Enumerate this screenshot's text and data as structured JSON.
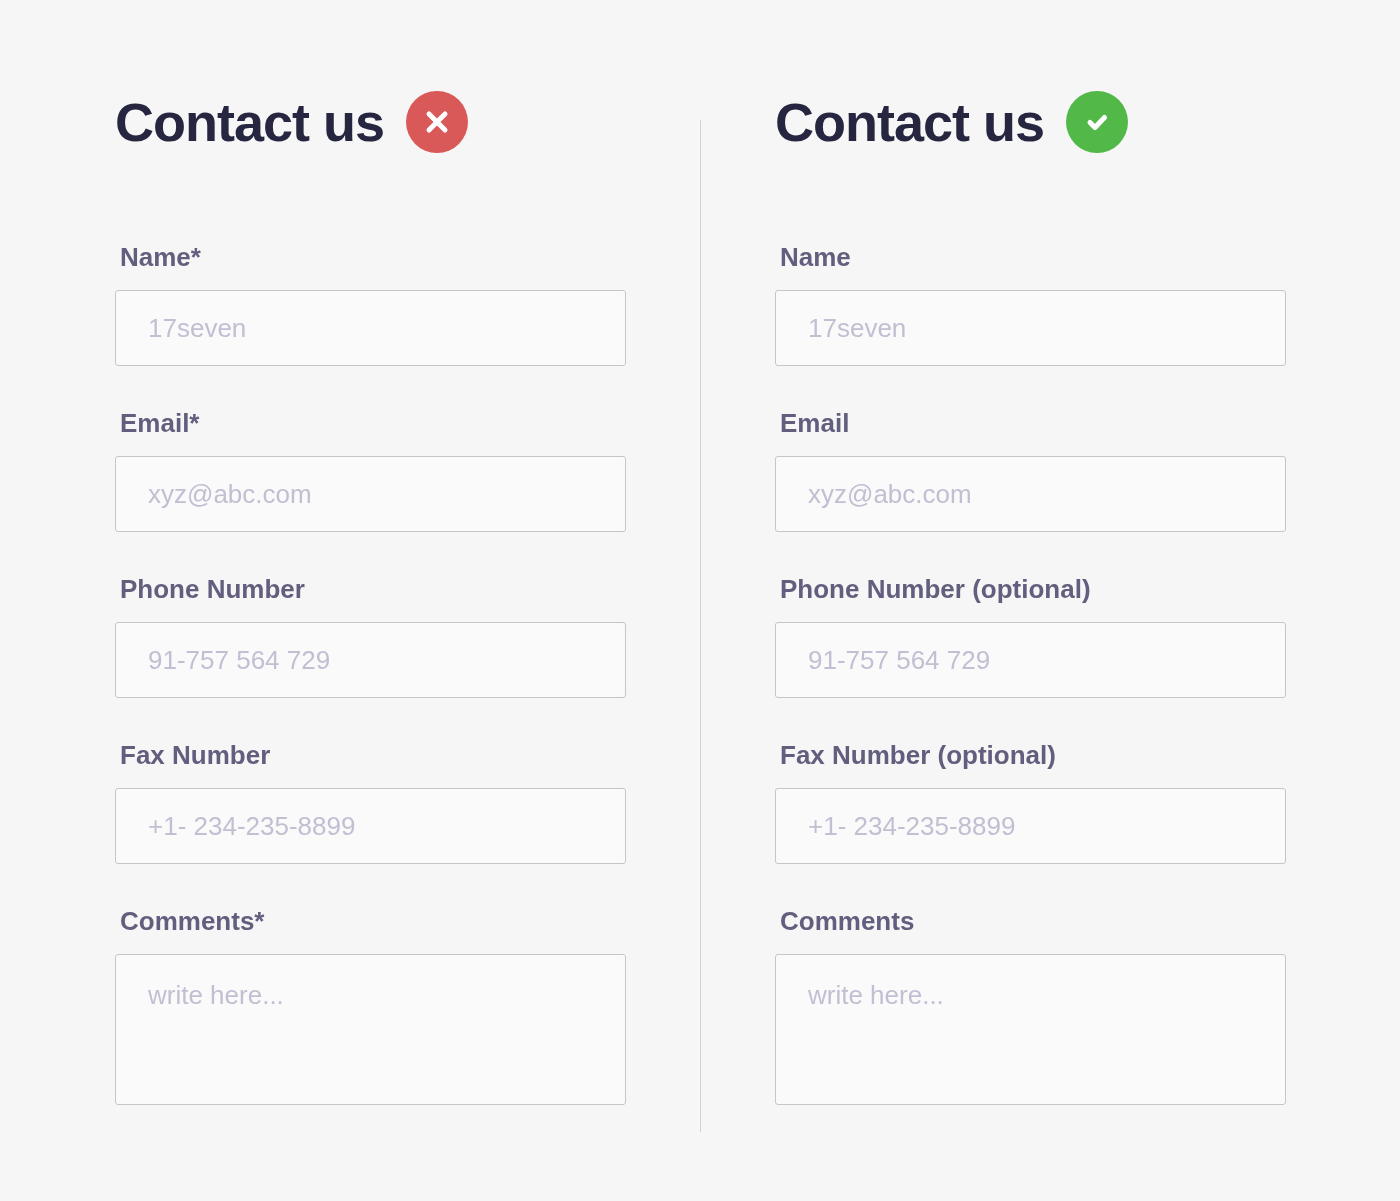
{
  "panels": [
    {
      "title": "Contact us",
      "kind": "cross",
      "fields": [
        {
          "kind": "input",
          "label": "Name*",
          "placeholder": "17seven"
        },
        {
          "kind": "input",
          "label": "Email*",
          "placeholder": "xyz@abc.com"
        },
        {
          "kind": "input",
          "label": "Phone Number",
          "placeholder": "91-757 564 729"
        },
        {
          "kind": "input",
          "label": "Fax Number",
          "placeholder": "+1- 234-235-8899"
        },
        {
          "kind": "textarea",
          "label": "Comments*",
          "placeholder": "write here..."
        }
      ]
    },
    {
      "title": "Contact us",
      "kind": "check",
      "fields": [
        {
          "kind": "input",
          "label": "Name",
          "placeholder": "17seven"
        },
        {
          "kind": "input",
          "label": "Email",
          "placeholder": "xyz@abc.com"
        },
        {
          "kind": "input",
          "label": "Phone Number (optional)",
          "placeholder": "91-757 564 729"
        },
        {
          "kind": "input",
          "label": "Fax Number (optional)",
          "placeholder": "+1- 234-235-8899"
        },
        {
          "kind": "textarea",
          "label": "Comments",
          "placeholder": "write here..."
        }
      ]
    }
  ]
}
